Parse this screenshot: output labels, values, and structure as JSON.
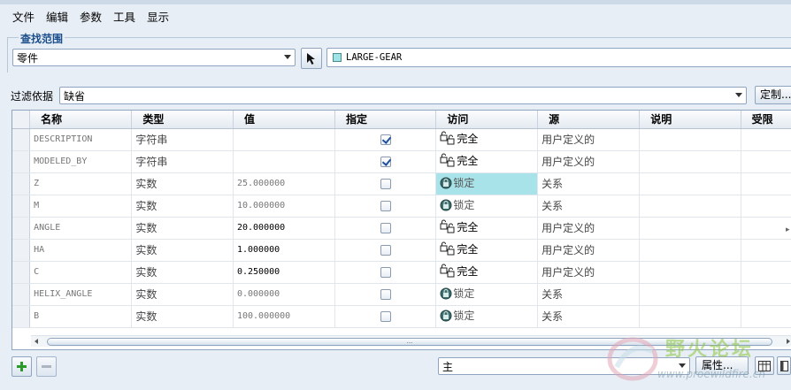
{
  "menu": [
    "文件",
    "编辑",
    "参数",
    "工具",
    "显示"
  ],
  "scope": {
    "title": "查找范围",
    "type_value": "零件",
    "model_name": "LARGE-GEAR"
  },
  "filter": {
    "label": "过滤依据",
    "value": "缺省",
    "custom_button": "定制..."
  },
  "table": {
    "headers": [
      "名称",
      "类型",
      "值",
      "指定",
      "访问",
      "源",
      "说明",
      "受限"
    ],
    "rows": [
      {
        "name": "DESCRIPTION",
        "type": "字符串",
        "value": "",
        "designate": true,
        "access": "完全",
        "access_icon": "full-access-icon",
        "source": "用户定义的",
        "value_dark": false
      },
      {
        "name": "MODELED_BY",
        "type": "字符串",
        "value": "",
        "designate": true,
        "access": "完全",
        "access_icon": "full-access-icon",
        "source": "用户定义的",
        "value_dark": false
      },
      {
        "name": "Z",
        "type": "实数",
        "value": "25.000000",
        "designate": false,
        "access": "锁定",
        "access_icon": "locked-icon",
        "source": "关系",
        "value_dark": false,
        "selected": true
      },
      {
        "name": "M",
        "type": "实数",
        "value": "10.000000",
        "designate": false,
        "access": "锁定",
        "access_icon": "locked-icon",
        "source": "关系",
        "value_dark": false
      },
      {
        "name": "ANGLE",
        "type": "实数",
        "value": "20.000000",
        "designate": false,
        "access": "完全",
        "access_icon": "full-access-icon",
        "source": "用户定义的",
        "value_dark": true
      },
      {
        "name": "HA",
        "type": "实数",
        "value": "1.000000",
        "designate": false,
        "access": "完全",
        "access_icon": "full-access-icon",
        "source": "用户定义的",
        "value_dark": true
      },
      {
        "name": "C",
        "type": "实数",
        "value": "0.250000",
        "designate": false,
        "access": "完全",
        "access_icon": "full-access-icon",
        "source": "用户定义的",
        "value_dark": true
      },
      {
        "name": "HELIX_ANGLE",
        "type": "实数",
        "value": "0.000000",
        "designate": false,
        "access": "锁定",
        "access_icon": "locked-icon",
        "source": "关系",
        "value_dark": false
      },
      {
        "name": "B",
        "type": "实数",
        "value": "100.000000",
        "designate": false,
        "access": "锁定",
        "access_icon": "locked-icon",
        "source": "关系",
        "value_dark": false
      }
    ]
  },
  "scrollbar_grip": "...",
  "bottom": {
    "main_select": "主",
    "properties_button": "属性..."
  },
  "watermark": {
    "title": "野火论坛",
    "url": "www.proewildfire.cn"
  },
  "colors": {
    "selected_cell": "#a9e3ea",
    "group_title": "#1a4f8c"
  }
}
